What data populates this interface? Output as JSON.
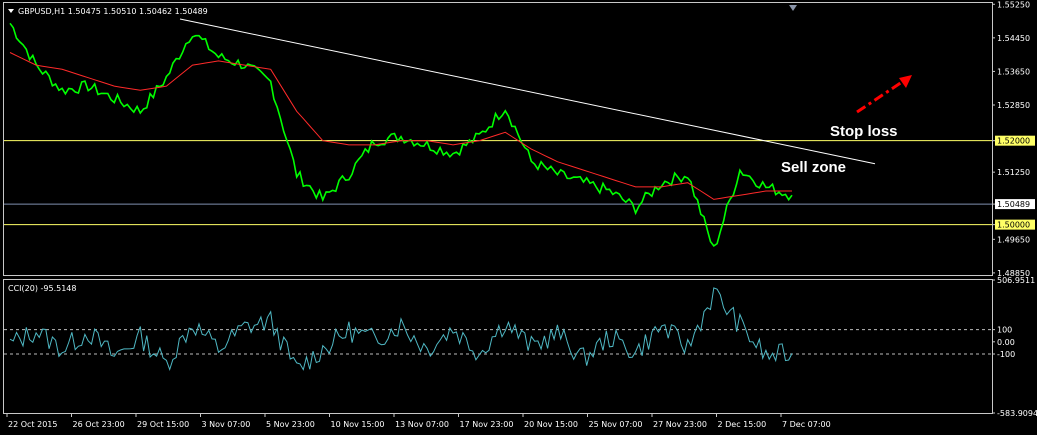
{
  "header": {
    "symbol_line": "GBPUSD,H1  1.50475 1.50510 1.50462 1.50489"
  },
  "indicator": {
    "label": "CCI(20) -95.5148",
    "value": -95.5148,
    "axis_labels": [
      "506.9511",
      "100",
      "0.00",
      "-100",
      "-583.9094"
    ]
  },
  "annotations": {
    "stop_loss": "Stop loss",
    "sell_zone": "Sell zone"
  },
  "colors": {
    "price_line": "#00ff00",
    "moving_average": "#ff2a2a",
    "trendline": "#ffffff",
    "horizontal_lines": "#ffff66",
    "current_price_line": "#8090b0",
    "cci_line": "#4fb8c4",
    "arrow": "#ff0000",
    "grid_text": "#ffffff",
    "frame": "#c8c8c8"
  },
  "chart_data": [
    {
      "type": "line",
      "title": "GBPUSD,H1",
      "x": [
        "22 Oct 2015",
        "26 Oct 23:00",
        "29 Oct 15:00",
        "3 Nov 07:00",
        "5 Nov 23:00",
        "10 Nov 15:00",
        "13 Nov 07:00",
        "17 Nov 23:00",
        "20 Nov 15:00",
        "25 Nov 07:00",
        "27 Nov 23:00",
        "2 Dec 15:00",
        "7 Dec 07:00"
      ],
      "y_ticks": [
        "1.55250",
        "1.54450",
        "1.53650",
        "1.52850",
        "1.52000",
        "1.51250",
        "1.50489",
        "1.50000",
        "1.49650",
        "1.48850"
      ],
      "ylim": [
        1.488,
        1.5528
      ],
      "series": [
        {
          "values": [
            1.548,
            1.538,
            1.532,
            1.533,
            1.53,
            1.527,
            1.535,
            1.546,
            1.54,
            1.538,
            1.534,
            1.512,
            1.506,
            1.512,
            1.52,
            1.521,
            1.519,
            1.517,
            1.521,
            1.528,
            1.515,
            1.512,
            1.51,
            1.508,
            1.504,
            1.51,
            1.512,
            1.494,
            1.513,
            1.509,
            1.507
          ]
        },
        {
          "values": [
            1.541,
            1.538,
            1.537,
            1.535,
            1.533,
            1.532,
            1.533,
            1.538,
            1.539,
            1.538,
            1.537,
            1.527,
            1.52,
            1.519,
            1.519,
            1.52,
            1.52,
            1.519,
            1.52,
            1.522,
            1.518,
            1.515,
            1.513,
            1.511,
            1.509,
            1.509,
            1.51,
            1.506,
            1.507,
            1.508,
            1.508
          ]
        }
      ],
      "horizontal_levels": [
        1.52,
        1.50489,
        1.5
      ],
      "trendline": {
        "from": [
          1.549,
          0.235
        ],
        "to": [
          1.5145,
          1.0
        ]
      }
    },
    {
      "type": "line",
      "title": "CCI(20)",
      "ylim": [
        -583.9094,
        506.9511
      ],
      "levels": [
        100,
        -100
      ],
      "series": [
        {
          "values": [
            -20,
            90,
            -60,
            80,
            -120,
            40,
            -180,
            150,
            -60,
            120,
            170,
            -230,
            -60,
            90,
            20,
            140,
            -60,
            110,
            -90,
            160,
            -40,
            70,
            -140,
            40,
            -90,
            130,
            -50,
            400,
            140,
            -120,
            -95
          ]
        }
      ]
    }
  ]
}
